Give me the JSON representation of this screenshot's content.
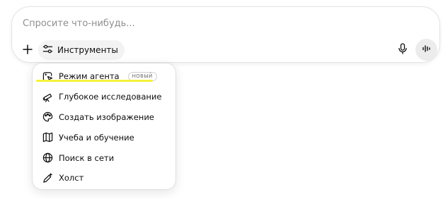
{
  "composer": {
    "placeholder": "Спросите что-нибудь...",
    "value": "",
    "tools_label": "Инструменты",
    "plus_icon": "plus-icon",
    "tools_icon": "sliders-icon",
    "mic_icon": "microphone-icon",
    "voice_icon": "voice-wave-icon"
  },
  "menu": {
    "items": [
      {
        "label": "Режим агента",
        "icon": "agent-cursor-icon",
        "badge": "НОВЫЙ"
      },
      {
        "label": "Глубокое исследование",
        "icon": "telescope-icon"
      },
      {
        "label": "Создать изображение",
        "icon": "palette-icon"
      },
      {
        "label": "Учеба и обучение",
        "icon": "book-icon"
      },
      {
        "label": "Поиск в сети",
        "icon": "globe-icon"
      },
      {
        "label": "Холст",
        "icon": "pen-sparkle-icon"
      }
    ]
  },
  "colors": {
    "highlight": "#f4f23a",
    "text": "#0d0d0d",
    "placeholder": "#8f8f8f",
    "border": "#e3e3e3"
  }
}
